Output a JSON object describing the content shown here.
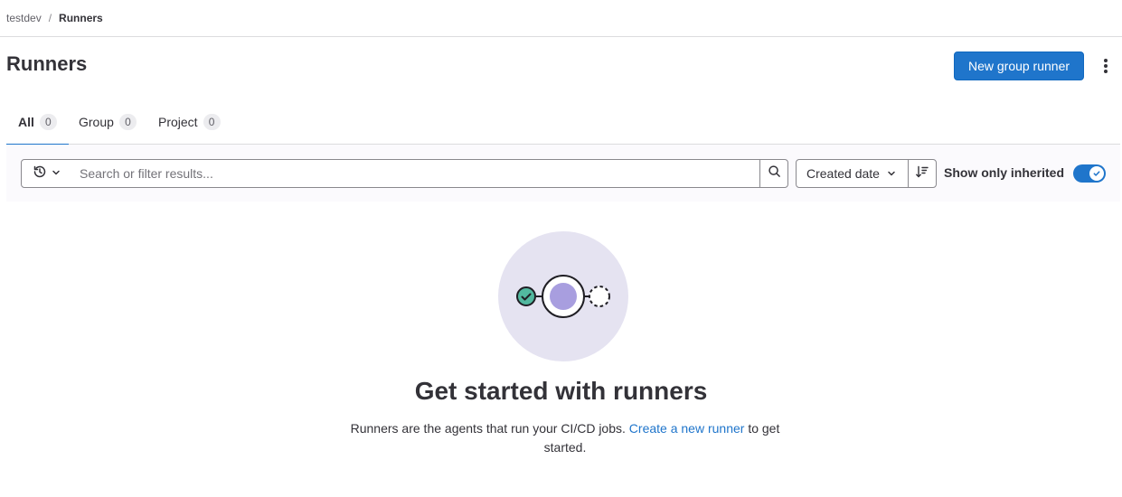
{
  "breadcrumb": {
    "items": [
      {
        "label": "testdev"
      },
      {
        "label": "Runners"
      }
    ],
    "separator": "/"
  },
  "header": {
    "title": "Runners",
    "primary_button": "New group runner",
    "more_actions_icon": "ellipsis-vertical-icon"
  },
  "tabs": [
    {
      "label": "All",
      "count": "0",
      "active": true
    },
    {
      "label": "Group",
      "count": "0",
      "active": false
    },
    {
      "label": "Project",
      "count": "0",
      "active": false
    }
  ],
  "filter": {
    "history_icon": "history-icon",
    "search_placeholder": "Search or filter results...",
    "search_icon": "search-icon",
    "sort_label": "Created date",
    "sort_direction_icon": "sort-lowest-icon",
    "toggle_label": "Show only inherited",
    "toggle_on": true
  },
  "empty_state": {
    "title": "Get started with runners",
    "description_before": "Runners are the agents that run your CI/CD jobs. ",
    "link_text": "Create a new runner",
    "description_after": " to get started."
  },
  "colors": {
    "primary": "#1f75cb",
    "illustration_bg": "#e5e3f1",
    "illustration_accent": "#a89edf",
    "success_teal": "#52b89f"
  }
}
